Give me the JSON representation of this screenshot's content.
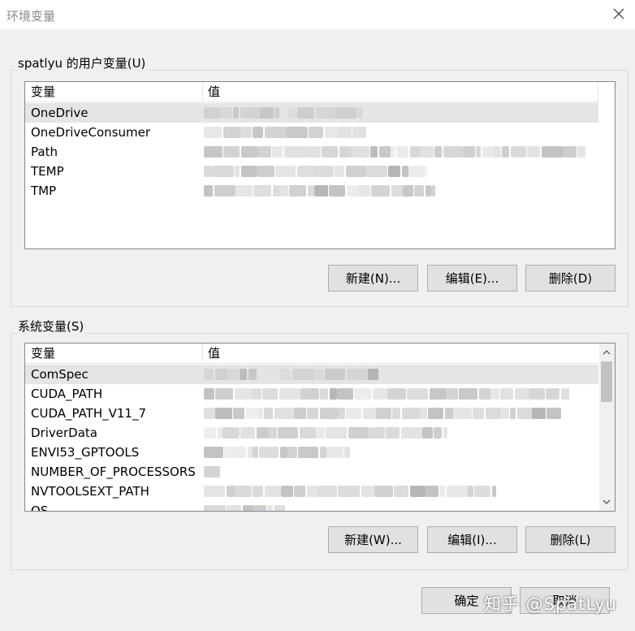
{
  "window": {
    "title": "环境变量",
    "close_icon": "close-icon"
  },
  "user_vars": {
    "group_label": "spatlyu 的用户变量(U)",
    "columns": {
      "name": "变量",
      "value": "值"
    },
    "rows": [
      {
        "name": "OneDrive",
        "selected": true
      },
      {
        "name": "OneDriveConsumer",
        "selected": false
      },
      {
        "name": "Path",
        "selected": false
      },
      {
        "name": "TEMP",
        "selected": false
      },
      {
        "name": "TMP",
        "selected": false
      }
    ],
    "buttons": {
      "new": "新建(N)...",
      "edit": "编辑(E)...",
      "delete": "删除(D)"
    }
  },
  "system_vars": {
    "group_label": "系统变量(S)",
    "columns": {
      "name": "变量",
      "value": "值"
    },
    "rows": [
      {
        "name": "ComSpec",
        "selected": true
      },
      {
        "name": "CUDA_PATH",
        "selected": false
      },
      {
        "name": "CUDA_PATH_V11_7",
        "selected": false
      },
      {
        "name": "DriverData",
        "selected": false
      },
      {
        "name": "ENVI53_GPTOOLS",
        "selected": false
      },
      {
        "name": "NUMBER_OF_PROCESSORS",
        "selected": false
      },
      {
        "name": "NVTOOLSEXT_PATH",
        "selected": false
      },
      {
        "name": "OS",
        "selected": false
      }
    ],
    "buttons": {
      "new": "新建(W)...",
      "edit": "编辑(I)...",
      "delete": "删除(L)"
    }
  },
  "dialog_buttons": {
    "ok": "确定",
    "cancel": "取消"
  },
  "watermark": "知乎 @SpatLyu"
}
